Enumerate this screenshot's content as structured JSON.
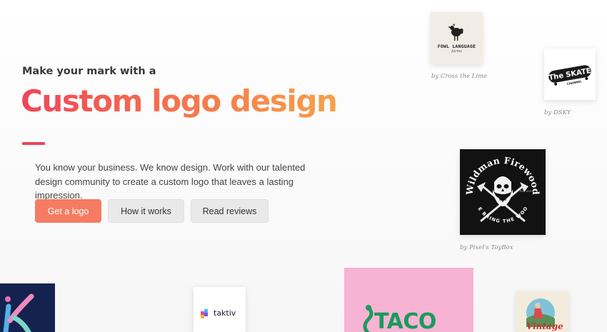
{
  "hero": {
    "eyebrow": "Make your mark with a",
    "headline": "Custom logo design",
    "description": "You know your business. We know design. Work with our talented design community to create a custom logo that leaves a lasting impression.",
    "accent_color": "#f0445a"
  },
  "actions": {
    "get_logo": "Get a logo",
    "how_it_works": "How it works",
    "read_reviews": "Read reviews"
  },
  "showcase": {
    "fowl": {
      "title": "FOWL LANGUAGE",
      "subtitle": "farms",
      "credit": "by Cross the Lime"
    },
    "skate": {
      "title": "The SKATE",
      "subtitle": "CHANNEL",
      "credit": "by DSKY"
    },
    "wildman": {
      "title": "Wildman Firewood",
      "tagline": "WE BRING THE WOOD",
      "badge": "EST 2016",
      "credit": "by Pixel's ToyBox"
    },
    "taktiv": {
      "name": "taktiv"
    },
    "taco": {
      "name": "TACO"
    },
    "vintage": {
      "name": "Vintage"
    }
  },
  "colors": {
    "primary_button": "#f57c63",
    "secondary_button": "#e9e9e9",
    "gradient_start": "#f0445a",
    "gradient_end": "#f7a04a"
  }
}
